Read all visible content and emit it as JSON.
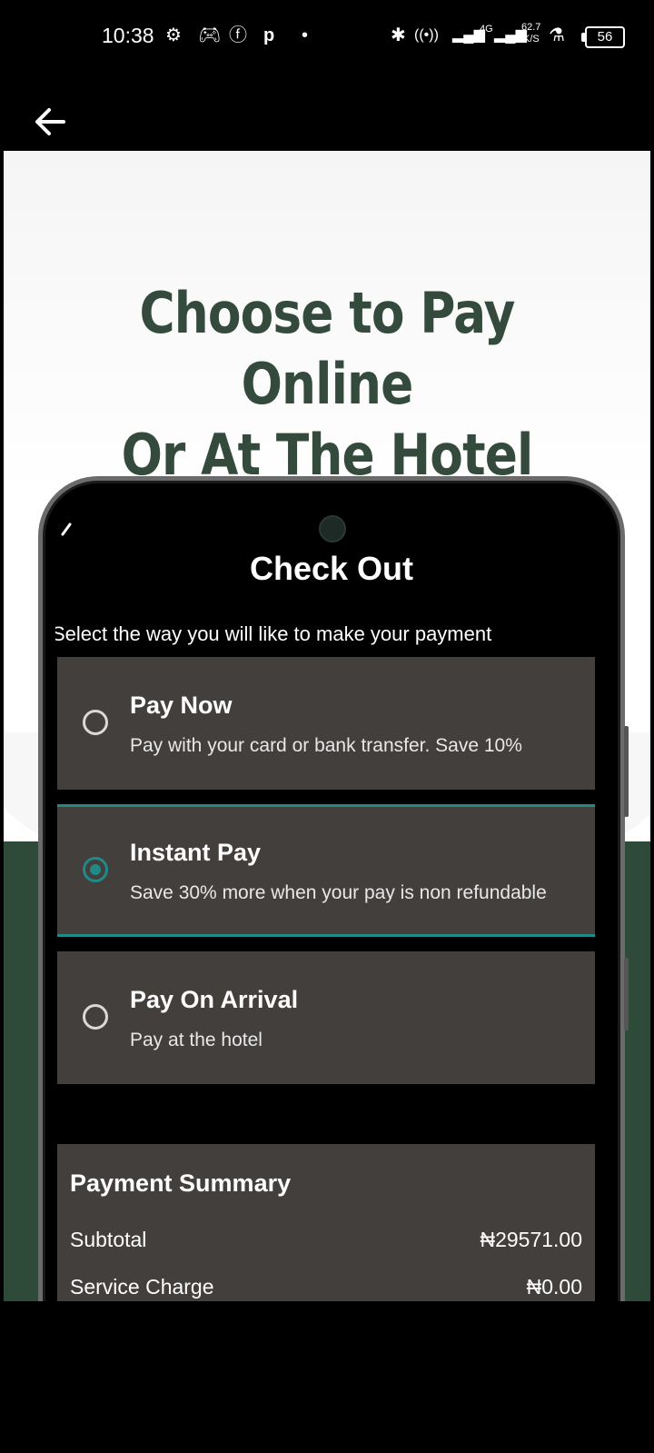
{
  "status_bar": {
    "time": "10:38",
    "network": "4G",
    "speed_value": "62.7",
    "speed_unit": "K/S",
    "battery": "56"
  },
  "app_bar": {
    "back_icon": "arrow-left-icon"
  },
  "promo": {
    "headline_line1": "Choose to Pay Online",
    "headline_line2": "Or At The Hotel"
  },
  "checkout": {
    "title": "Check Out",
    "subtitle": "Select the way you will like to make your payment",
    "options": [
      {
        "title": "Pay Now",
        "description": "Pay with your card or bank transfer. Save 10%",
        "selected": false
      },
      {
        "title": "Instant Pay",
        "description": "Save 30% more when your pay is non refundable",
        "selected": true
      },
      {
        "title": "Pay On Arrival",
        "description": "Pay at the hotel",
        "selected": false
      }
    ],
    "summary": {
      "title": "Payment Summary",
      "rows": [
        {
          "label": "Subtotal",
          "value": "₦29571.00"
        },
        {
          "label": "Service Charge",
          "value": "₦0.00"
        }
      ]
    }
  },
  "colors": {
    "headline": "#334a3c",
    "accent": "#1f8a86",
    "card": "#433f3d",
    "green_bg": "#2e4b3a"
  }
}
